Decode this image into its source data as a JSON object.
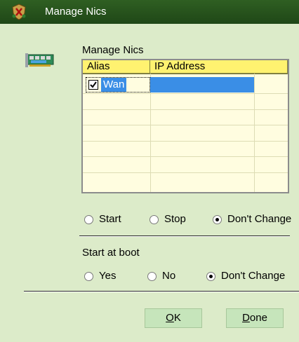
{
  "window": {
    "title": "Manage Nics",
    "colors": {
      "titlebar": "#1f4717",
      "background": "#dcebc9",
      "grid": "#fffde0",
      "header": "#fff270",
      "selection": "#3a8ee6"
    }
  },
  "nics": {
    "label": "Manage Nics",
    "columns": [
      "Alias",
      "IP Address"
    ],
    "rows": [
      {
        "checked": true,
        "alias": "Wan",
        "ip": ""
      }
    ]
  },
  "action": {
    "options": [
      "Start",
      "Stop",
      "Don't Change"
    ],
    "selected": "Don't Change"
  },
  "boot": {
    "label": "Start at boot",
    "options": [
      "Yes",
      "No",
      "Don't Change"
    ],
    "selected": "Don't Change"
  },
  "buttons": {
    "ok": {
      "mnemonic": "O",
      "rest": "K"
    },
    "done": {
      "mnemonic": "D",
      "rest": "one"
    }
  },
  "icons": {
    "app": "shield-icon",
    "nic": "network-card-icon"
  }
}
